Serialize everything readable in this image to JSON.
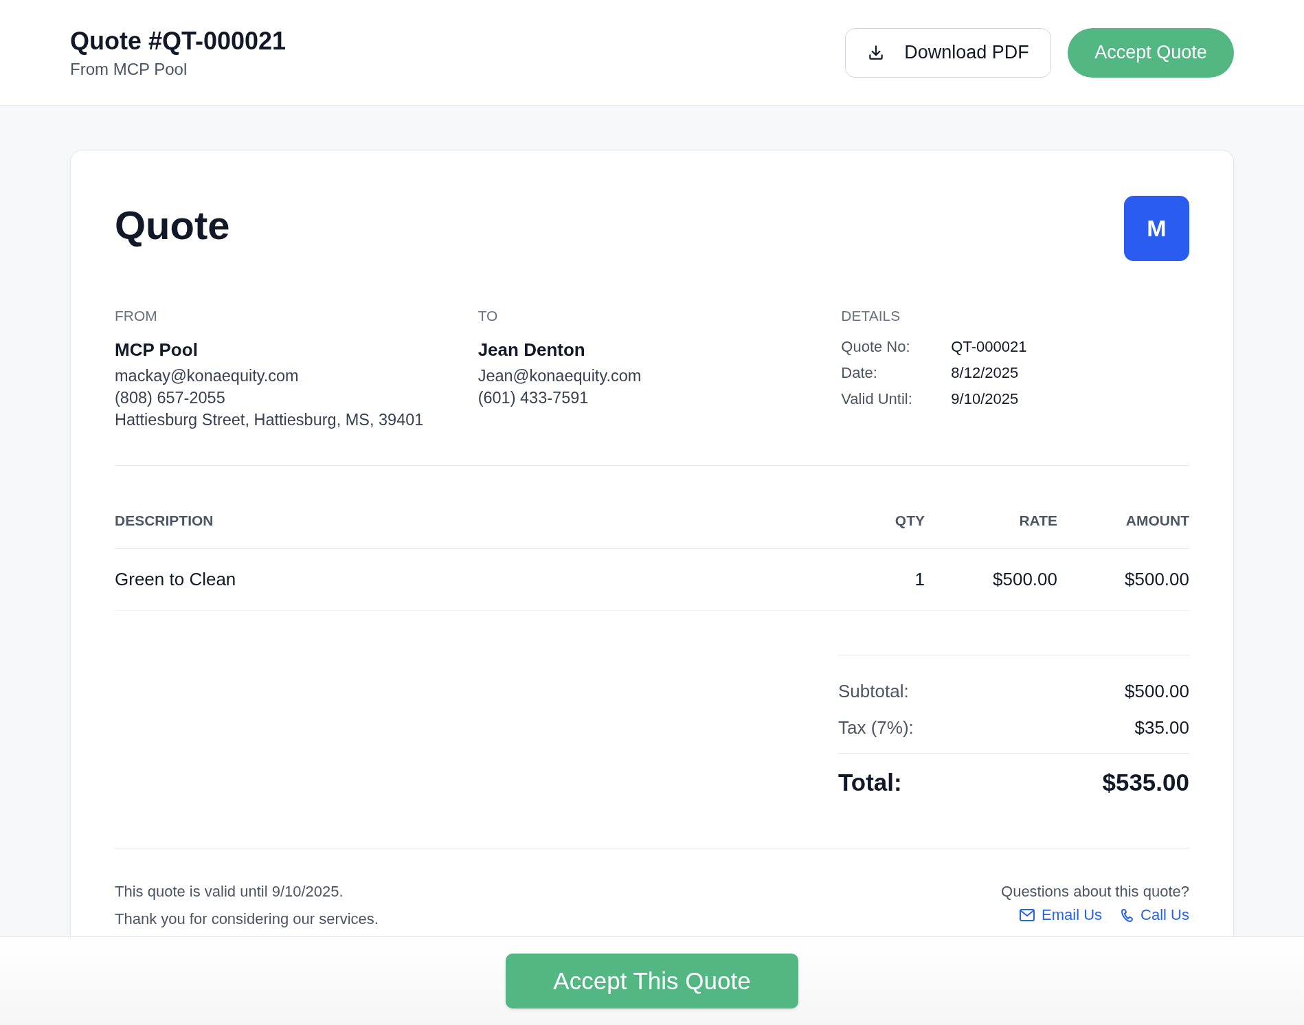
{
  "header": {
    "title": "Quote #QT-000021",
    "subtitle": "From MCP Pool",
    "buttons": [
      {
        "kind": "secondary",
        "label": "Download PDF"
      },
      {
        "kind": "primary",
        "label": "Accept Quote"
      }
    ]
  },
  "document": {
    "heading": "Quote",
    "logo": "M",
    "parties": [
      {
        "label": "FROM",
        "name": "MCP Pool",
        "lines": [
          "mackay@konaequity.com",
          "(808) 657-2055",
          "Hattiesburg Street, Hattiesburg, MS, 39401"
        ]
      },
      {
        "label": "TO",
        "name": "Jean Denton",
        "lines": [
          "Jean@konaequity.com",
          "(601) 433-7591"
        ]
      }
    ],
    "details": {
      "label": "DETAILS",
      "rows": [
        {
          "key": "Quote No:",
          "value": "QT-000021"
        },
        {
          "key": "Date:",
          "value": "8/12/2025"
        },
        {
          "key": "Valid Until:",
          "value": "9/10/2025"
        }
      ]
    },
    "table": {
      "columns": [
        "DESCRIPTION",
        "QTY",
        "RATE",
        "AMOUNT"
      ],
      "rows": [
        {
          "cells": [
            "Green to Clean",
            "1",
            "$500.00",
            "$500.00"
          ]
        }
      ]
    },
    "totals": [
      {
        "kind": "line",
        "label": "Subtotal:",
        "value": "$500.00"
      },
      {
        "kind": "line",
        "label": "Tax (7%):",
        "value": "$35.00"
      },
      {
        "kind": "grand",
        "label": "Total:",
        "value": "$535.00"
      }
    ],
    "footer": {
      "notes": [
        "This quote is valid until 9/10/2025.",
        "Thank you for considering our services."
      ],
      "question": "Questions about this quote?",
      "links": [
        {
          "kind": "email",
          "label": "Email Us"
        },
        {
          "kind": "phone",
          "label": "Call Us"
        }
      ]
    }
  },
  "bottom_bar": {
    "button": "Accept This Quote"
  }
}
